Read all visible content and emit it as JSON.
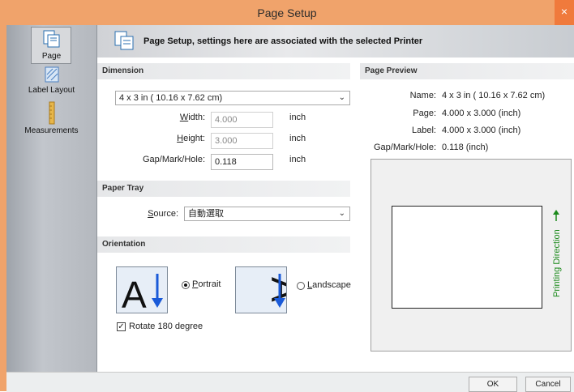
{
  "window": {
    "title": "Page Setup",
    "close_glyph": "×"
  },
  "sidebar": {
    "items": [
      {
        "label": "Page",
        "icon": "page-icon"
      },
      {
        "label": "Label Layout",
        "icon": "label-layout-icon"
      },
      {
        "label": "Measurements",
        "icon": "ruler-icon"
      }
    ]
  },
  "banner": {
    "text": "Page Setup, settings here are associated with the selected Printer"
  },
  "dimension": {
    "header": "Dimension",
    "size_value": "4 x 3 in ( 10.16 x 7.62 cm)",
    "width_label_pre": "",
    "width_label_u": "W",
    "width_label_post": "idth:",
    "width_value": "4.000",
    "height_label_u": "H",
    "height_label_post": "eight:",
    "height_value": "3.000",
    "gap_label": "Gap/Mark/Hole:",
    "gap_value": "0.118",
    "unit": "inch"
  },
  "paper_tray": {
    "header": "Paper Tray",
    "source_label_u": "S",
    "source_label_post": "ource:",
    "source_value": "自動選取"
  },
  "orientation": {
    "header": "Orientation",
    "portrait_u": "P",
    "portrait_post": "ortrait",
    "landscape_u": "L",
    "landscape_post": "andscape",
    "selected": "portrait",
    "rotate_label": "Rotate 180 degree",
    "rotate_checked": true
  },
  "preview": {
    "header": "Page Preview",
    "name_label": "Name:",
    "name_value": "4 x 3 in ( 10.16 x 7.62 cm)",
    "page_label": "Page:",
    "page_value": "4.000  x  3.000  (inch)",
    "label_label": "Label:",
    "label_value": "4.000  x  3.000  (inch)",
    "gap_label": "Gap/Mark/Hole:",
    "gap_value": "0.118  (inch)",
    "direction_text": "Printing Direction"
  },
  "buttons": {
    "ok": "OK",
    "cancel": "Cancel"
  },
  "colors": {
    "titlebar": "#f0a36b",
    "close": "#f07a3c",
    "accent_green": "#1b8a1b",
    "arrow_blue": "#1a5ad8"
  }
}
